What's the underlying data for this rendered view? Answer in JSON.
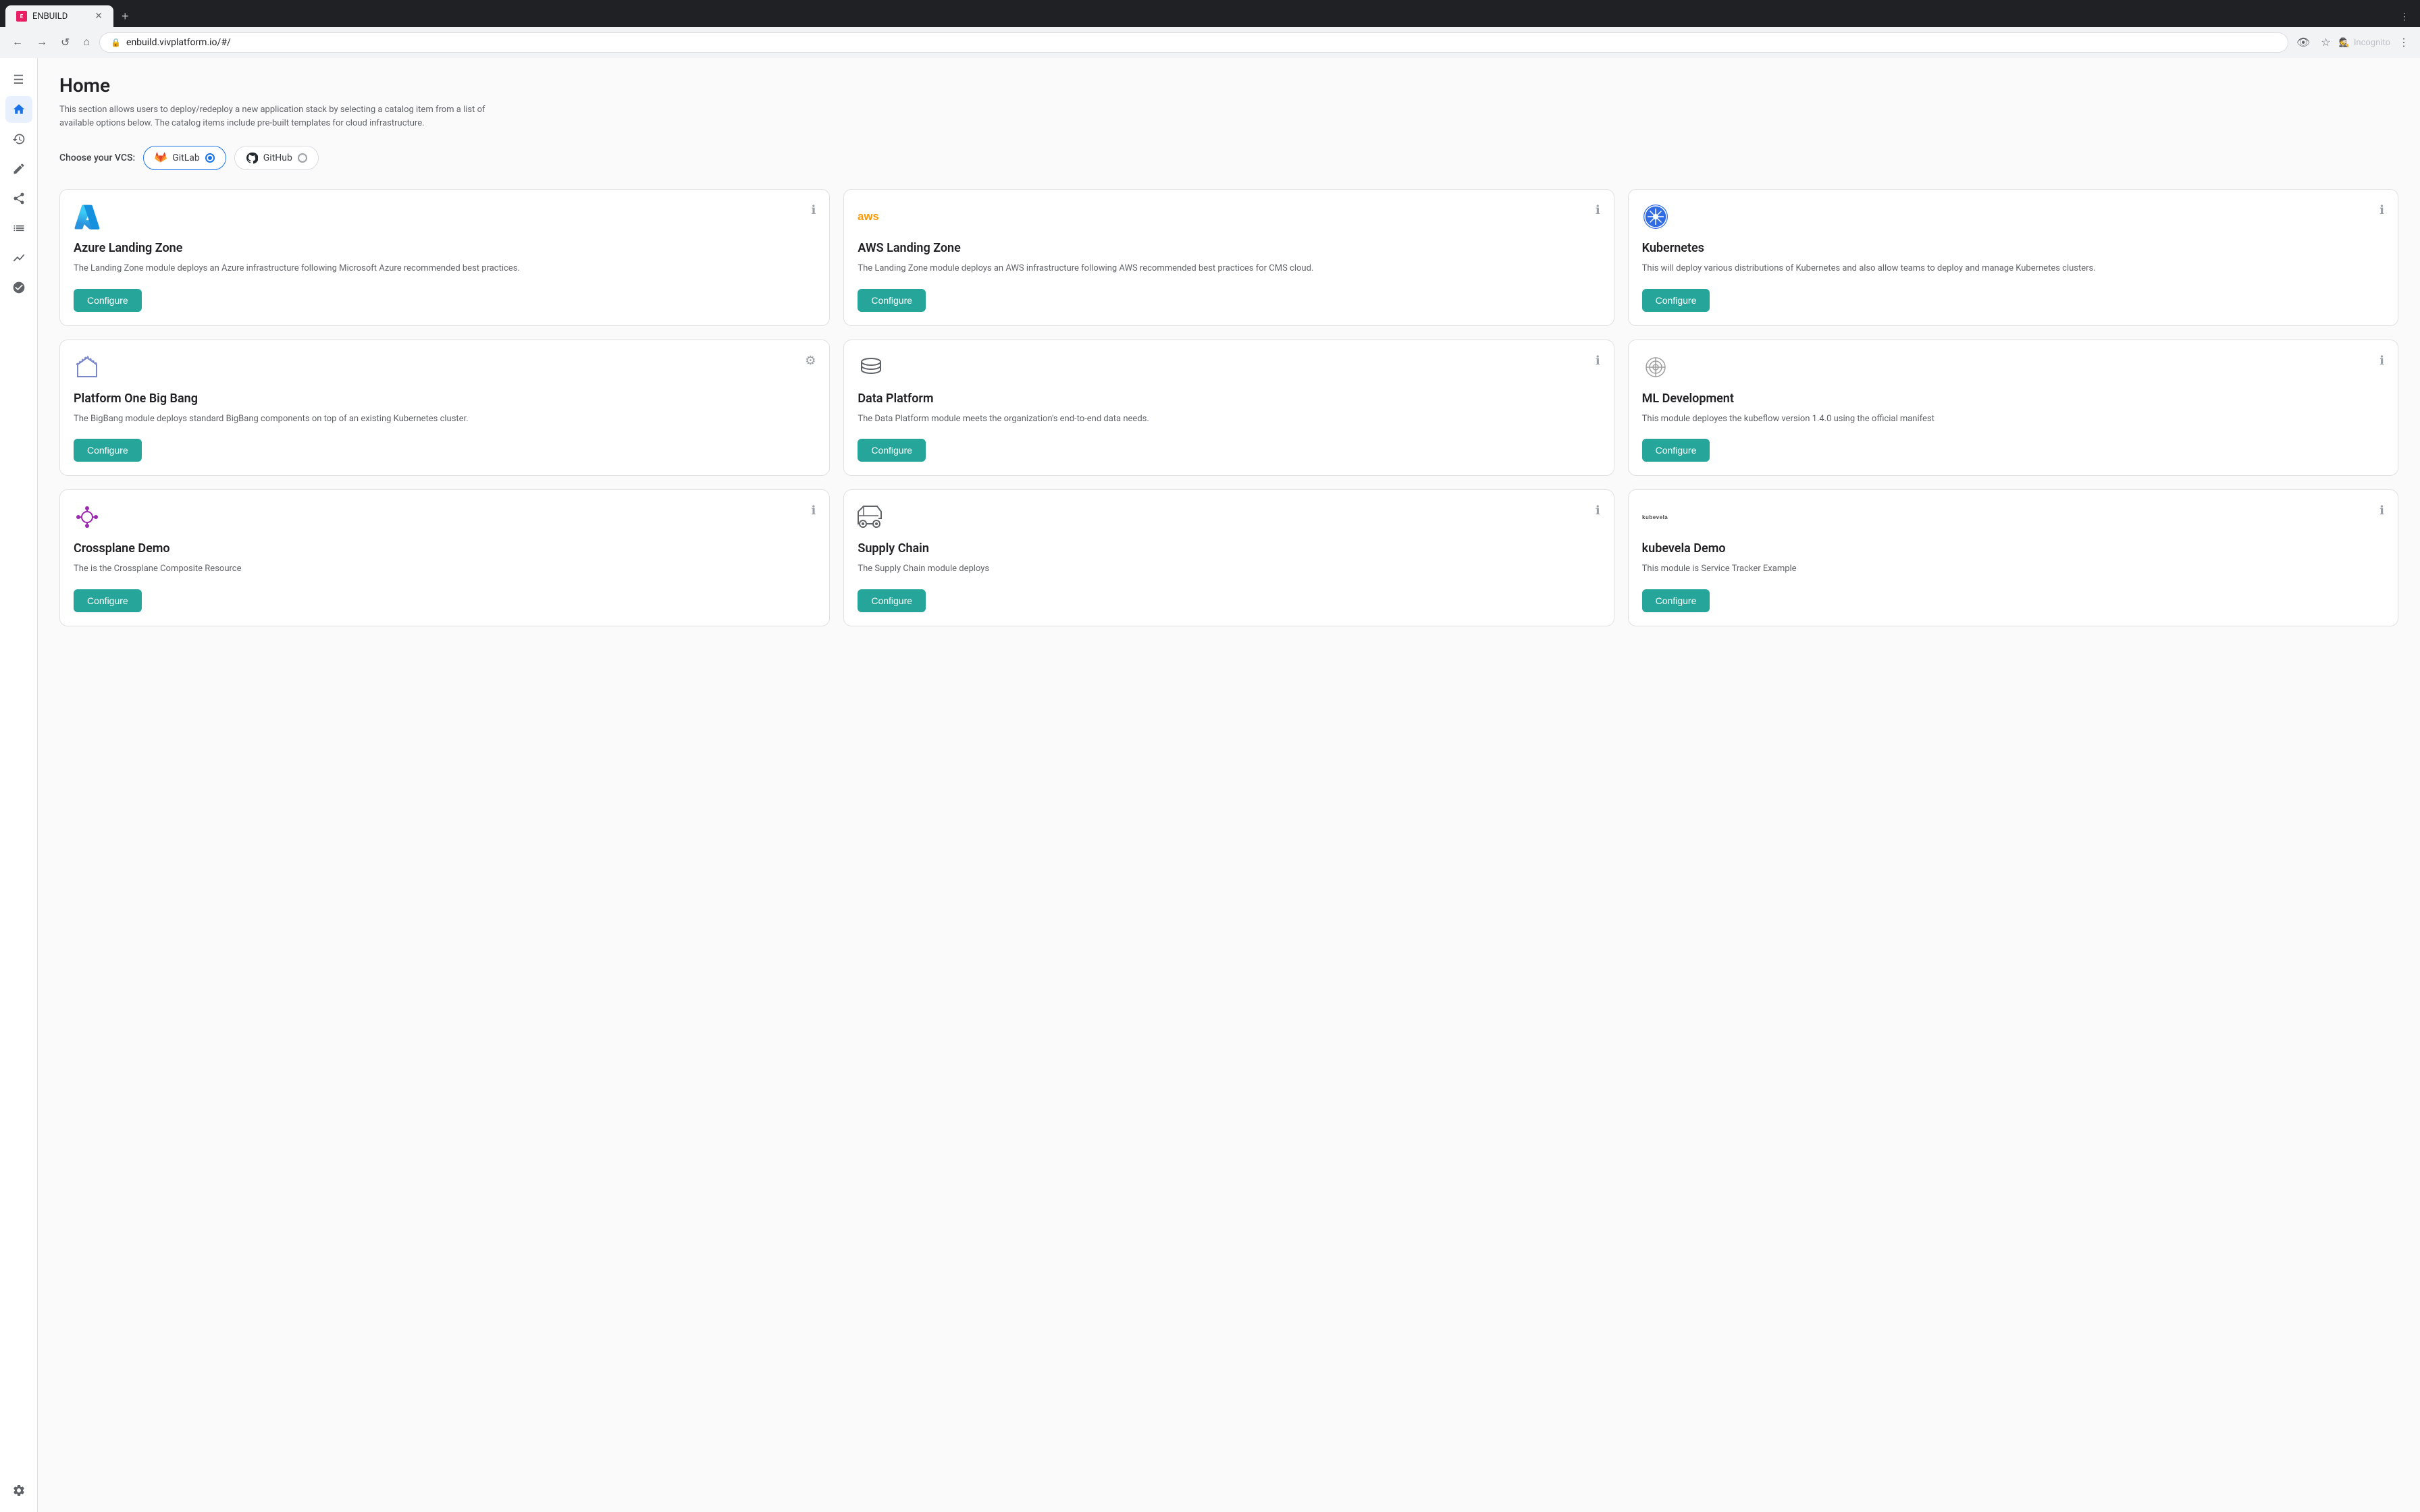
{
  "browser": {
    "tab_label": "ENBUILD",
    "url": "enbuild.vivplatform.io/#/",
    "incognito_label": "Incognito"
  },
  "page": {
    "title": "Home",
    "subtitle": "This section allows users to deploy/redeploy a new application stack by selecting a catalog item from a list of available options below. The catalog items include pre-built templates for cloud infrastructure."
  },
  "vcs": {
    "label": "Choose your VCS:",
    "options": [
      {
        "id": "gitlab",
        "label": "GitLab",
        "selected": true
      },
      {
        "id": "github",
        "label": "GitHub",
        "selected": false
      }
    ]
  },
  "sidebar": {
    "items": [
      {
        "id": "menu",
        "icon": "☰",
        "label": "Menu"
      },
      {
        "id": "home",
        "icon": "⌂",
        "label": "Home",
        "active": true
      },
      {
        "id": "clock",
        "icon": "◷",
        "label": "History"
      },
      {
        "id": "edit",
        "icon": "✎",
        "label": "Edit"
      },
      {
        "id": "share",
        "icon": "⇄",
        "label": "Share"
      },
      {
        "id": "chart",
        "icon": "▦",
        "label": "Chart"
      },
      {
        "id": "analytics",
        "icon": "∿",
        "label": "Analytics"
      },
      {
        "id": "settings-circle",
        "icon": "◉",
        "label": "Settings Circle"
      }
    ],
    "bottom_items": [
      {
        "id": "settings",
        "icon": "⚙",
        "label": "Settings"
      }
    ]
  },
  "cards": [
    {
      "id": "azure-landing-zone",
      "title": "Azure Landing Zone",
      "description": "The Landing Zone module deploys an Azure infrastructure following Microsoft Azure recommended best practices.",
      "icon_type": "azure",
      "configure_label": "Configure",
      "row": 1
    },
    {
      "id": "aws-landing-zone",
      "title": "AWS Landing Zone",
      "description": "The Landing Zone module deploys an AWS infrastructure following AWS recommended best practices for CMS cloud.",
      "icon_type": "aws",
      "configure_label": "Configure",
      "row": 1
    },
    {
      "id": "kubernetes",
      "title": "Kubernetes",
      "description": "This will deploy various distributions of Kubernetes and also allow teams to deploy and manage Kubernetes clusters.",
      "icon_type": "k8s",
      "configure_label": "Configure",
      "row": 1
    },
    {
      "id": "platform-one-big-bang",
      "title": "Platform One Big Bang",
      "description": "The BigBang module deploys standard BigBang components on top of an existing Kubernetes cluster.",
      "icon_type": "bigbang",
      "configure_label": "Configure",
      "row": 2
    },
    {
      "id": "data-platform",
      "title": "Data Platform",
      "description": "The Data Platform module meets the organization's end-to-end data needs.",
      "icon_type": "database",
      "configure_label": "Configure",
      "row": 2
    },
    {
      "id": "ml-development",
      "title": "ML Development",
      "description": "This module deployes the kubeflow version 1.4.0 using the official manifest",
      "icon_type": "ml",
      "configure_label": "Configure",
      "row": 2
    },
    {
      "id": "crossplane-demo",
      "title": "Crossplane Demo",
      "description": "The is the Crossplane Composite Resource",
      "icon_type": "crossplane",
      "configure_label": "Configure",
      "row": 3
    },
    {
      "id": "supply-chain",
      "title": "Supply Chain",
      "description": "The Supply Chain module deploys",
      "icon_type": "chain",
      "configure_label": "Configure",
      "row": 3
    },
    {
      "id": "kubevela-demo",
      "title": "kubevela Demo",
      "description": "This module is Service Tracker Example",
      "icon_type": "kubevela",
      "configure_label": "Configure",
      "row": 3
    }
  ]
}
